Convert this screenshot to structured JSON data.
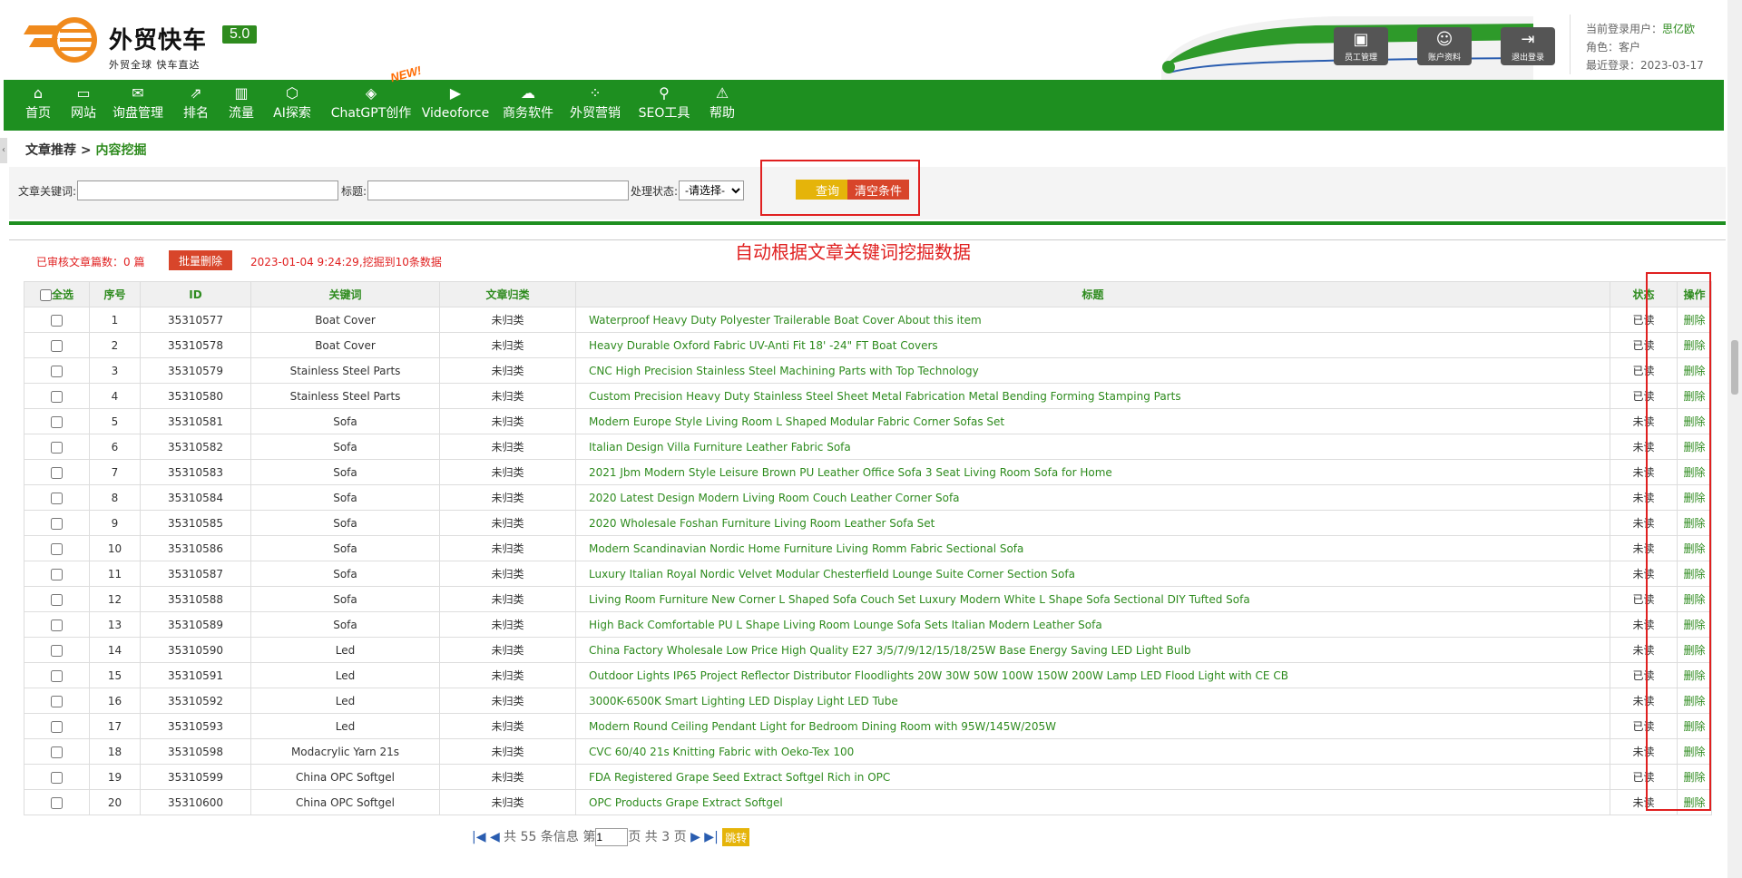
{
  "brand": {
    "title": "外贸快车",
    "subtitle": "外贸全球 快车直达",
    "version": "5.0"
  },
  "header_buttons": [
    {
      "label": "员工管理"
    },
    {
      "label": "账户资料"
    },
    {
      "label": "退出登录"
    }
  ],
  "user": {
    "current_label": "当前登录用户：",
    "current_value": "思亿欧",
    "role_label": "角色：",
    "role_value": "客户",
    "last_label": "最近登录：",
    "last_value": "2023-03-17"
  },
  "nav": [
    {
      "label": "首页",
      "icon": "home-icon",
      "glyph": "⌂"
    },
    {
      "label": "网站",
      "icon": "monitor-icon",
      "glyph": "▭"
    },
    {
      "label": "询盘管理",
      "icon": "mail-icon",
      "glyph": "✉"
    },
    {
      "label": "排名",
      "icon": "ranking-icon",
      "glyph": "⇗"
    },
    {
      "label": "流量",
      "icon": "bar-chart-icon",
      "glyph": "▥"
    },
    {
      "label": "AI探索",
      "icon": "ai-icon",
      "glyph": "⬡"
    },
    {
      "label": "ChatGPT创作",
      "icon": "chatgpt-icon",
      "glyph": "◈"
    },
    {
      "label": "Videoforce",
      "icon": "video-icon",
      "glyph": "▶"
    },
    {
      "label": "商务软件",
      "icon": "cloud-icon",
      "glyph": "☁"
    },
    {
      "label": "外贸营销",
      "icon": "grid-icon",
      "glyph": "⁘"
    },
    {
      "label": "SEO工具",
      "icon": "search-icon",
      "glyph": "⚲"
    },
    {
      "label": "帮助",
      "icon": "warning-icon",
      "glyph": "⚠"
    }
  ],
  "new_badge": "NEW!",
  "breadcrumb": {
    "parent": "文章推荐",
    "sep": " > ",
    "current": "内容挖掘"
  },
  "filter": {
    "keyword_label": "文章关键词:",
    "title_label": "标题:",
    "status_label": "处理状态:",
    "status_selected": "-请选择-",
    "query_btn": "查询",
    "clear_btn": "清空条件"
  },
  "stats": "已审核文章篇数：0 篇",
  "batch_delete": "批量删除",
  "mine_info": "2023-01-04 9:24:29,挖掘到10条数据",
  "annotation": "自动根据文章关键词挖掘数据",
  "table": {
    "headers": [
      "全选",
      "序号",
      "ID",
      "关键词",
      "文章归类",
      "标题",
      "状态",
      "操作"
    ],
    "rows": [
      [
        "1",
        "35310577",
        "Boat Cover",
        "未归类",
        "Waterproof Heavy Duty Polyester Trailerable Boat Cover About this item",
        "已读",
        "删除"
      ],
      [
        "2",
        "35310578",
        "Boat Cover",
        "未归类",
        "Heavy Durable Oxford Fabric UV-Anti Fit 18' -24\" FT Boat Covers",
        "已读",
        "删除"
      ],
      [
        "3",
        "35310579",
        "Stainless Steel Parts",
        "未归类",
        "CNC High Precision Stainless Steel Machining Parts with Top Technology",
        "已读",
        "删除"
      ],
      [
        "4",
        "35310580",
        "Stainless Steel Parts",
        "未归类",
        "Custom Precision Heavy Duty Stainless Steel Sheet Metal Fabrication Metal Bending Forming Stamping Parts",
        "已读",
        "删除"
      ],
      [
        "5",
        "35310581",
        "Sofa",
        "未归类",
        "Modern Europe Style Living Room L Shaped Modular Fabric Corner Sofas Set",
        "未读",
        "删除"
      ],
      [
        "6",
        "35310582",
        "Sofa",
        "未归类",
        "Italian Design Villa Furniture Leather Fabric Sofa",
        "未读",
        "删除"
      ],
      [
        "7",
        "35310583",
        "Sofa",
        "未归类",
        "2021 Jbm Modern Style Leisure Brown PU Leather Office Sofa 3 Seat Living Room Sofa for Home",
        "未读",
        "删除"
      ],
      [
        "8",
        "35310584",
        "Sofa",
        "未归类",
        "2020 Latest Design Modern Living Room Couch Leather Corner Sofa",
        "未读",
        "删除"
      ],
      [
        "9",
        "35310585",
        "Sofa",
        "未归类",
        "2020 Wholesale Foshan Furniture Living Room Leather Sofa Set",
        "未读",
        "删除"
      ],
      [
        "10",
        "35310586",
        "Sofa",
        "未归类",
        "Modern Scandinavian Nordic Home Furniture Living Romm Fabric Sectional Sofa",
        "未读",
        "删除"
      ],
      [
        "11",
        "35310587",
        "Sofa",
        "未归类",
        "Luxury Italian Royal Nordic Velvet Modular Chesterfield Lounge Suite Corner Section Sofa",
        "未读",
        "删除"
      ],
      [
        "12",
        "35310588",
        "Sofa",
        "未归类",
        "Living Room Furniture New Corner L Shaped Sofa Couch Set Luxury Modern White L Shape Sofa Sectional DIY Tufted Sofa",
        "已读",
        "删除"
      ],
      [
        "13",
        "35310589",
        "Sofa",
        "未归类",
        "High Back Comfortable PU L Shape Living Room Lounge Sofa Sets Italian Modern Leather Sofa",
        "未读",
        "删除"
      ],
      [
        "14",
        "35310590",
        "Led",
        "未归类",
        "China Factory Wholesale Low Price High Quality E27 3/5/7/9/12/15/18/25W Base Energy Saving LED Light Bulb",
        "未读",
        "删除"
      ],
      [
        "15",
        "35310591",
        "Led",
        "未归类",
        "Outdoor Lights IP65 Project Reflector Distributor Floodlights 20W 30W 50W 100W 150W 200W Lamp LED Flood Light with CE CB",
        "已读",
        "删除"
      ],
      [
        "16",
        "35310592",
        "Led",
        "未归类",
        "3000K-6500K Smart Lighting LED Display Light LED Tube",
        "未读",
        "删除"
      ],
      [
        "17",
        "35310593",
        "Led",
        "未归类",
        "Modern Round Ceiling Pendant Light for Bedroom Dining Room with 95W/145W/205W",
        "已读",
        "删除"
      ],
      [
        "18",
        "35310598",
        "Modacrylic Yarn 21s",
        "未归类",
        "CVC 60/40 21s Knitting Fabric with Oeko-Tex 100",
        "未读",
        "删除"
      ],
      [
        "19",
        "35310599",
        "China OPC Softgel",
        "未归类",
        "FDA Registered Grape Seed Extract Softgel Rich in OPC",
        "已读",
        "删除"
      ],
      [
        "20",
        "35310600",
        "China OPC Softgel",
        "未归类",
        "OPC Products Grape Extract Softgel",
        "未读",
        "删除"
      ]
    ]
  },
  "pager": {
    "total_text": "共 55 条信息 第",
    "page_value": "1",
    "pages_text": "页 共 3 页",
    "go": "跳转"
  },
  "colors": {
    "primary": "#1e8f20",
    "accent_red": "#e02020",
    "query_yellow": "#e5b40a"
  }
}
